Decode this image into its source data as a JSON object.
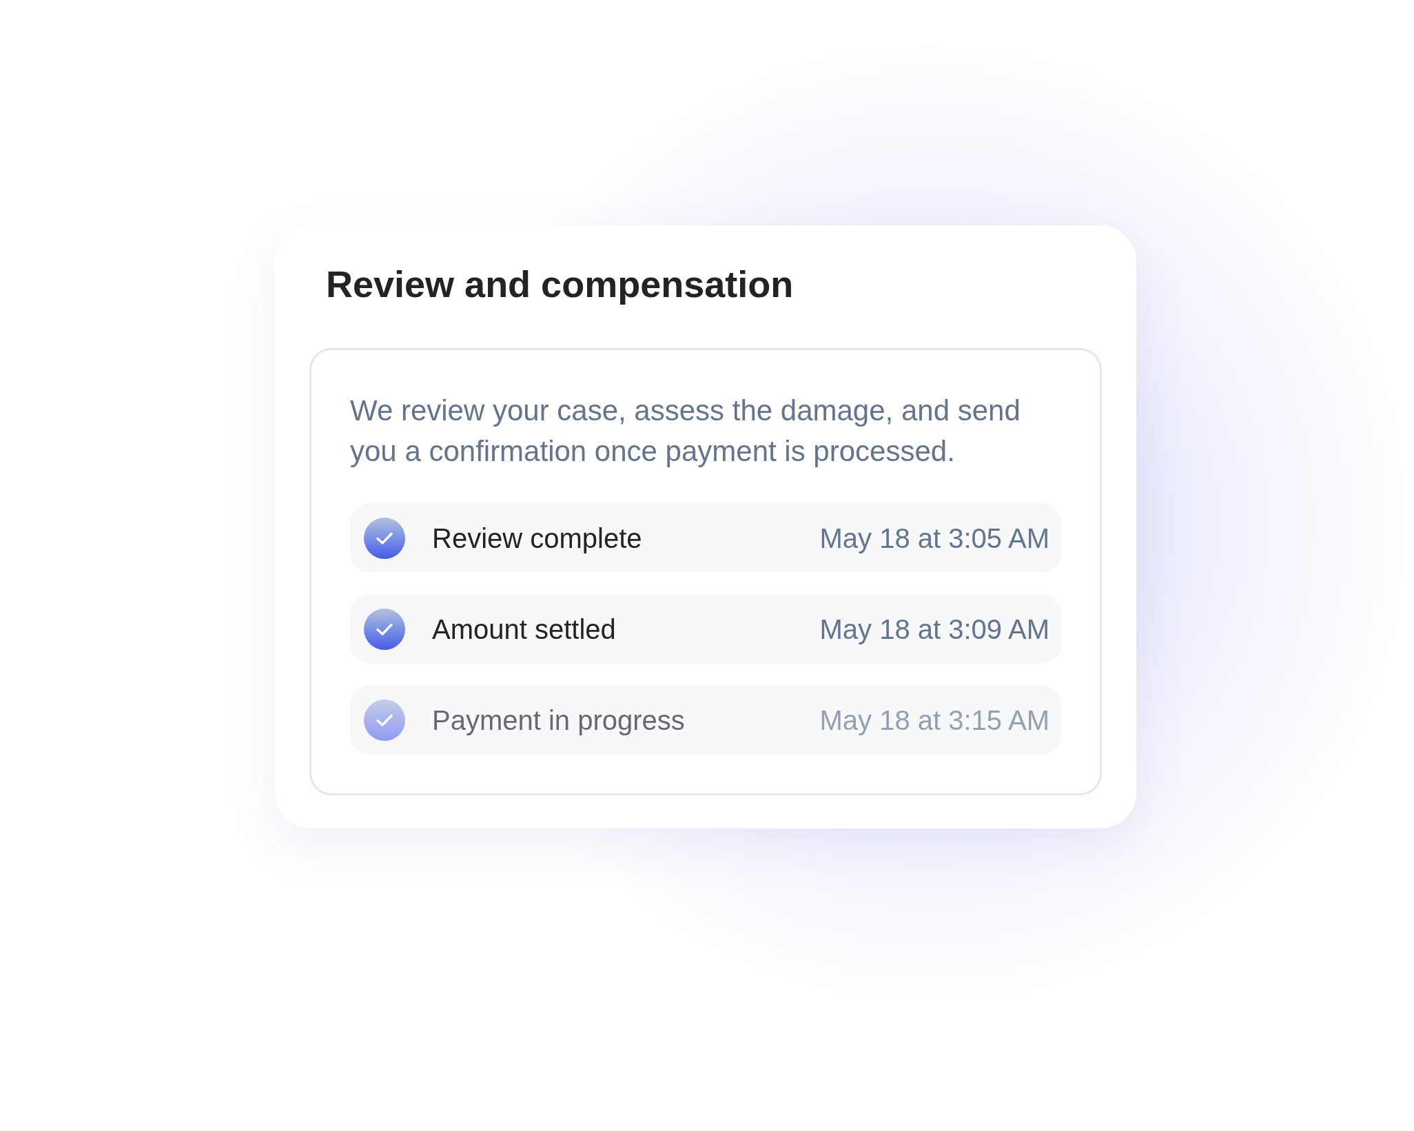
{
  "card": {
    "title": "Review and compensation",
    "description": "We review your case, assess the damage, and send you a confirmation once payment is processed.",
    "steps": [
      {
        "label": "Review complete",
        "time": "May 18 at 3:05 AM",
        "done": true
      },
      {
        "label": "Amount settled",
        "time": "May 18 at 3:09 AM",
        "done": true
      },
      {
        "label": "Payment in progress",
        "time": "May 18 at 3:15 AM",
        "done": false
      }
    ]
  }
}
